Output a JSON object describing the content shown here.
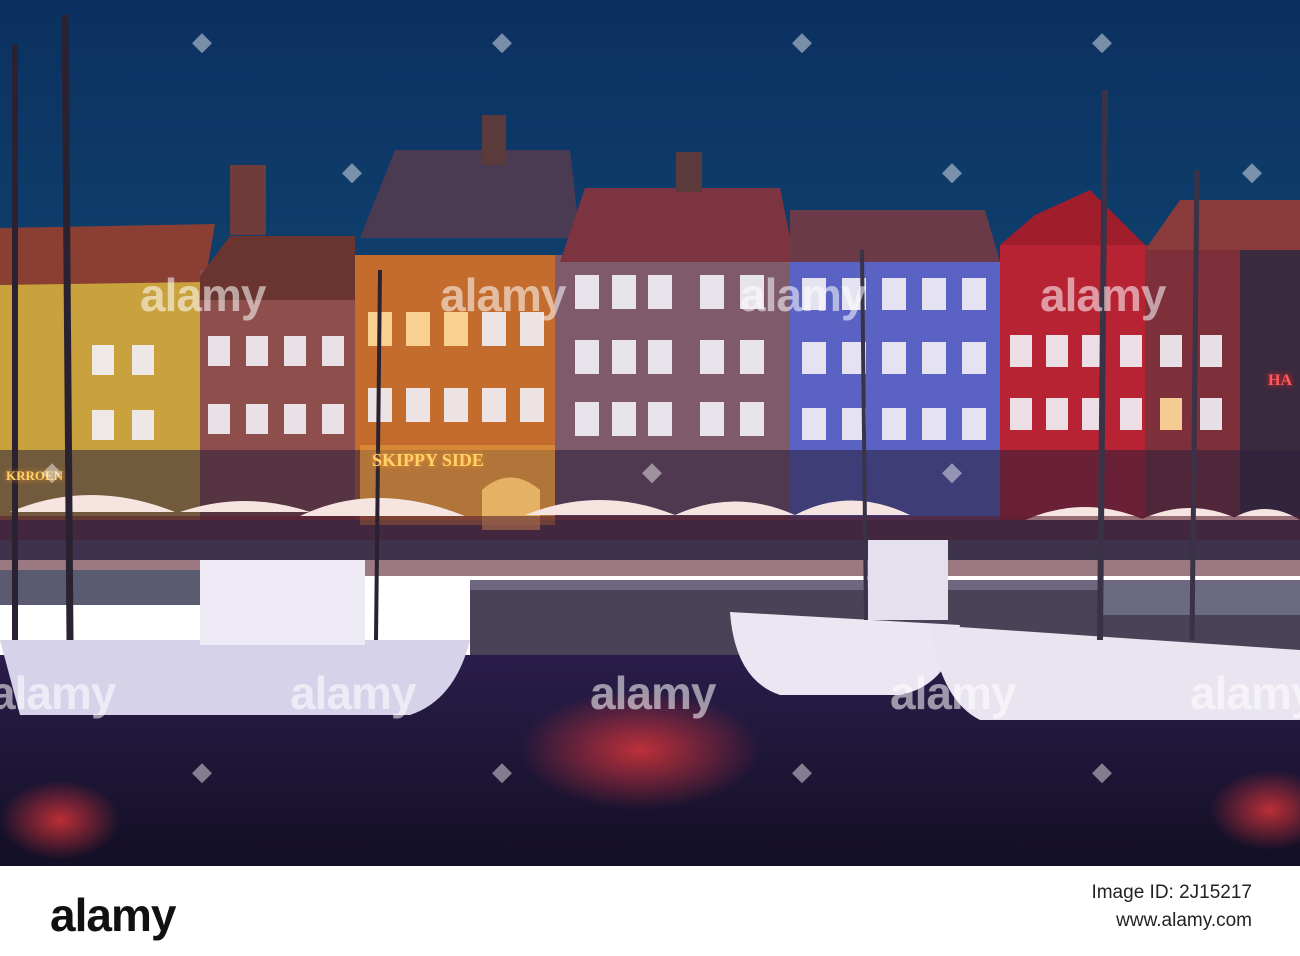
{
  "watermark": {
    "text": "alamy",
    "dots": "◆"
  },
  "signs": {
    "left_restaurant": "KRROEN",
    "center_bar": "SKIPPY SIDE",
    "right_neon": "HA"
  },
  "footer": {
    "brand": "alamy",
    "line1": "Image ID: 2J15217",
    "line2": "www.alamy.com"
  },
  "colors": {
    "sky": "#0e3a63",
    "water": "#1a1633",
    "footer_bg": "#ffffff"
  }
}
